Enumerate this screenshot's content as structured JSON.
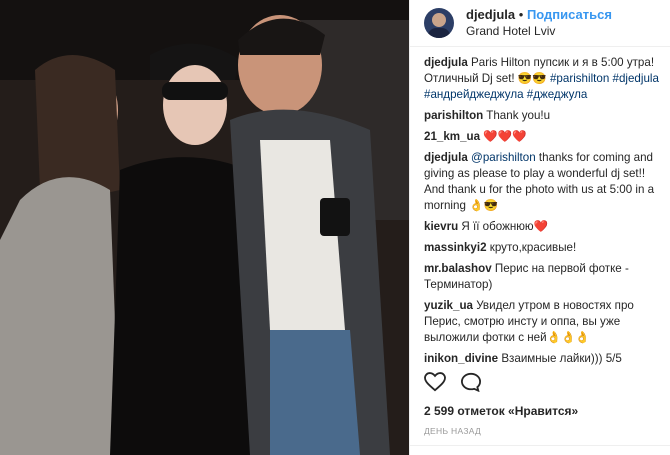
{
  "header": {
    "username": "djedjula",
    "separator": "•",
    "follow_label": "Подписаться",
    "location": "Grand Hotel Lviv"
  },
  "comments": [
    {
      "user": "djedjula",
      "text": "Paris Hilton пупсик и я в 5:00 утра! Отличный Dj set! 😎😎",
      "tags": "#parishilton #djedjula #андрейджеджула #джеджула"
    },
    {
      "user": "parishilton",
      "text": "Thank you!u"
    },
    {
      "user": "21_km_ua",
      "text": "❤️❤️❤️"
    },
    {
      "user": "djedjula",
      "mention": "@parishilton",
      "text": "thanks for coming and giving as please to play a wonderful dj set!! And thank u for the photo with us at 5:00 in a morning 👌😎"
    },
    {
      "user": "kievru",
      "text": "Я її обожнюю❤️"
    },
    {
      "user": "massinkyi2",
      "text": "круто,красивые!"
    },
    {
      "user": "mr.balashov",
      "text": "Перис на первой фотке - Терминатор)"
    },
    {
      "user": "yuzik_ua",
      "text": "Увидел утром в новостях про Перис, смотрю инсту и оппа, вы уже выложили фотки с ней👌👌👌"
    },
    {
      "user": "inikon_divine",
      "text": "Взаимные лайки))) 5/5"
    }
  ],
  "likes_label": "2 599 отметок «Нравится»",
  "time_label": "ДЕНЬ НАЗАД"
}
